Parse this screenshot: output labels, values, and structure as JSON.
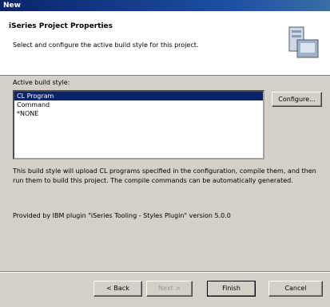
{
  "window": {
    "title": "New"
  },
  "header": {
    "title": "iSeries Project Properties",
    "description": "Select and configure the active build style for this project.",
    "icon": "project-wizard-icon"
  },
  "build_style": {
    "label": "Active build style:",
    "items": [
      "CL Program",
      "Command",
      "*NONE"
    ],
    "selected": "CL Program",
    "configure_label": "Configure..."
  },
  "description": "This build style will upload CL programs specified in the configuration, compile them, and then run them to build this project.  The compile commands can be automatically generated.",
  "provided_by": "Provided by IBM plugin \"iSeries Tooling - Styles Plugin\" version 5.0.0",
  "buttons": {
    "back": "< Back",
    "next": "Next >",
    "finish": "Finish",
    "cancel": "Cancel"
  }
}
